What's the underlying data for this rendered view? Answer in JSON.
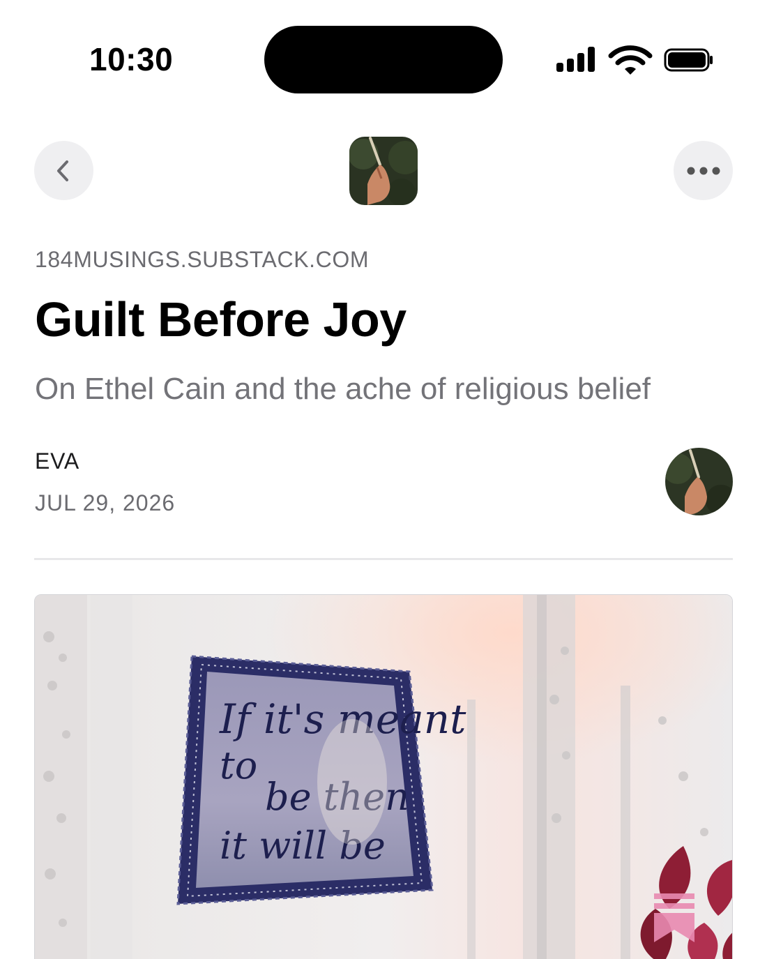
{
  "status_bar": {
    "time": "10:30",
    "icons": [
      "cellular-signal-icon",
      "wifi-icon",
      "battery-icon"
    ]
  },
  "nav": {
    "back_icon": "chevron-left-icon",
    "more_icon": "more-horizontal-icon",
    "logo": "publication-logo"
  },
  "post": {
    "domain": "184MUSINGS.SUBSTACK.COM",
    "title": "Guilt Before Joy",
    "subtitle": "On Ethel Cain and the ache of religious belief",
    "author": "EVA",
    "date": "JUL 29, 2026"
  },
  "hero_image": {
    "description": "photo of a crocheted wall hanging",
    "embroidered_text": "If it's meant to be then it will be",
    "badge_icon": "substack-bookmark-icon"
  },
  "colors": {
    "background": "#ffffff",
    "text_primary": "#000000",
    "text_secondary": "#6b6b70",
    "nav_button_bg": "#efeff1",
    "substack_badge": "#e88ab0"
  }
}
